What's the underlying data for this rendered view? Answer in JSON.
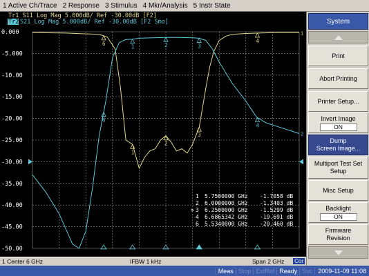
{
  "menu": [
    "1 Active Ch/Trace",
    "2 Response",
    "3 Stimulus",
    "4 Mkr/Analysis",
    "5 Instr State"
  ],
  "trace_header": {
    "line1": "Tr1 S11 Log Mag 5.000dB/ Ref -30.00dB [F2]",
    "line2": "S21 Log Mag 5.000dB/ Ref -30.00dB [F2 Smo]",
    "line2_badge": "Tr2"
  },
  "colors": {
    "trace1": "#e0d98a",
    "trace2": "#5cc7d6",
    "grid": "#9a9a9a",
    "ref_arrow": "#5cc7d6",
    "panel_title": "#3a58a8"
  },
  "chart_data": {
    "type": "line",
    "ylim": [
      -50,
      0
    ],
    "yticks": [
      "0.000",
      "-5.000",
      "-10.00",
      "-15.00",
      "-20.00",
      "-25.00",
      "-30.00",
      "-35.00",
      "-40.00",
      "-45.00",
      "-50.00"
    ],
    "reference_level": "-30.00",
    "x_center": "Center 6 GHz",
    "x_span": "Span 2 GHz",
    "x_range_ghz": [
      5.0,
      7.0
    ],
    "series": [
      {
        "id": "Tr1 S11",
        "x": [
          5.0,
          5.25,
          5.5,
          5.56,
          5.62,
          5.66,
          5.7,
          5.75,
          5.8,
          5.84,
          5.88,
          5.92,
          5.96,
          6.0,
          6.04,
          6.08,
          6.12,
          6.16,
          6.2,
          6.25,
          6.3,
          6.33,
          6.36,
          6.4,
          6.45,
          6.5,
          6.6,
          6.7,
          6.8,
          6.9,
          7.0
        ],
        "y": [
          -0.2,
          -0.3,
          -0.6,
          -1.2,
          -4.0,
          -13.0,
          -25.0,
          -26.0,
          -31.5,
          -29.0,
          -27.5,
          -27.0,
          -25.0,
          -24.0,
          -25.5,
          -27.5,
          -27.0,
          -28.0,
          -26.0,
          -22.0,
          -13.0,
          -8.0,
          -4.5,
          -2.0,
          -1.0,
          -0.6,
          -0.4,
          -0.3,
          -0.2,
          -0.2,
          -0.2
        ]
      },
      {
        "id": "Tr2 S21",
        "x": [
          5.0,
          5.1,
          5.2,
          5.3,
          5.35,
          5.4,
          5.45,
          5.5,
          5.55,
          5.6,
          5.65,
          5.7,
          5.75,
          5.8,
          5.9,
          6.0,
          6.1,
          6.2,
          6.25,
          6.3,
          6.35,
          6.4,
          6.5,
          6.6,
          6.68,
          6.75,
          6.85,
          6.95,
          7.0
        ],
        "y": [
          -33.0,
          -37.0,
          -42.0,
          -49.0,
          -50.0,
          -46.0,
          -36.0,
          -24.0,
          -16.0,
          -6.0,
          -2.5,
          -1.8,
          -1.7,
          -1.5,
          -1.4,
          -1.3,
          -1.3,
          -1.4,
          -1.5,
          -2.0,
          -4.0,
          -7.0,
          -12.0,
          -16.0,
          -19.7,
          -21.0,
          -22.0,
          -23.0,
          -23.5
        ]
      }
    ],
    "markers": [
      {
        "n": "1",
        "sym": "",
        "freq": "5.7500000 GHz",
        "value": "-1.7058 dB"
      },
      {
        "n": "2",
        "sym": "",
        "freq": "6.0000000 GHz",
        "value": "-1.3403 dB"
      },
      {
        "n": "3",
        "sym": ">",
        "freq": "6.2500000 GHz",
        "value": "-1.5299 dB"
      },
      {
        "n": "4",
        "sym": "",
        "freq": "6.6865342 GHz",
        "value": "-19.691 dB"
      },
      {
        "n": "6",
        "sym": "",
        "freq": "5.5340000 GHz",
        "value": "-20.460 dB"
      }
    ]
  },
  "status_bar": {
    "left": "1  Center 6 GHz",
    "middle": "IFBW 1 kHz",
    "right": "Span 2 GHz",
    "cor": "Cor"
  },
  "indicators": [
    {
      "label": "Meas",
      "on": true
    },
    {
      "label": "Stop",
      "on": false
    },
    {
      "label": "ExtRef",
      "on": false
    },
    {
      "label": "Ready",
      "on": true
    },
    {
      "label": "Svc",
      "on": false
    }
  ],
  "timestamp": "2009-11-09 11:08",
  "softkeys": {
    "title": "System",
    "print": "Print",
    "abort": "Abort Printing",
    "printer_setup": "Printer Setup...",
    "invert_image": "Invert Image",
    "invert_value": "ON",
    "dump_line1": "Dump",
    "dump_line2": "Screen Image...",
    "multiport_line1": "Multiport Test Set",
    "multiport_line2": "Setup",
    "misc": "Misc Setup",
    "backlight": "Backlight",
    "backlight_value": "ON",
    "firmware_line1": "Firmware",
    "firmware_line2": "Revision"
  }
}
